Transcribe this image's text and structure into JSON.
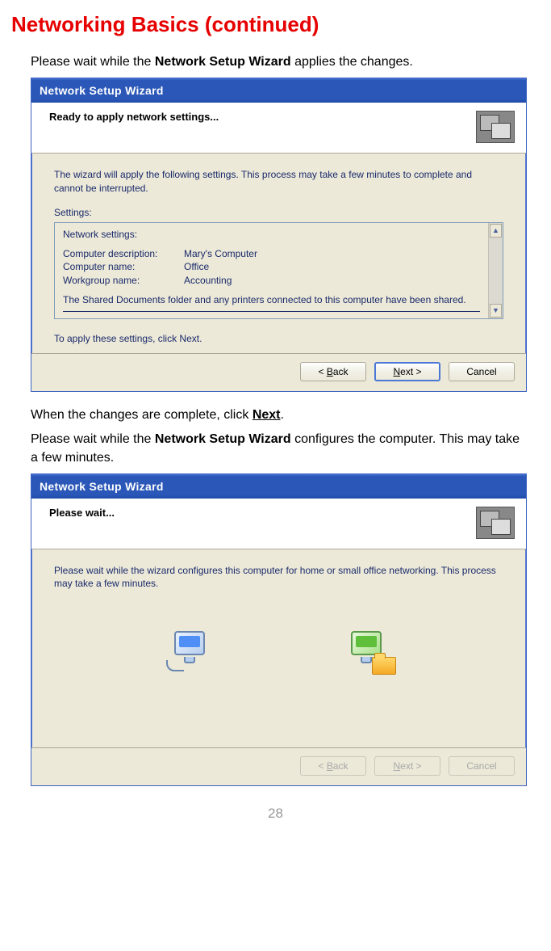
{
  "page": {
    "title": "Networking Basics (continued)",
    "intro_prefix": "Please wait while the ",
    "intro_bold": "Network Setup Wizard",
    "intro_suffix": " applies the changes.",
    "mid1_prefix": "When the changes are complete, click ",
    "mid1_bold": "Next",
    "mid1_suffix": ".",
    "mid2_prefix": "Please wait while the ",
    "mid2_bold": "Network Setup Wizard",
    "mid2_suffix": " configures the computer. This may take a few minutes.",
    "page_number": "28"
  },
  "dialog1": {
    "title": "Network Setup Wizard",
    "header": "Ready to apply network settings...",
    "para1": "The wizard will apply the following settings. This process may take a few minutes to complete and cannot be interrupted.",
    "settings_label": "Settings:",
    "box": {
      "heading": "Network settings:",
      "rows": [
        {
          "k": "Computer description:",
          "v": "Mary's Computer"
        },
        {
          "k": "Computer name:",
          "v": "Office"
        },
        {
          "k": "Workgroup name:",
          "v": "Accounting"
        }
      ],
      "note": "The Shared Documents folder and any printers connected to this computer have been shared."
    },
    "apply_text": "To apply these settings, click Next.",
    "buttons": {
      "back_pre": "< ",
      "back_u": "B",
      "back_post": "ack",
      "next_u": "N",
      "next_post": "ext >",
      "cancel": "Cancel"
    }
  },
  "dialog2": {
    "title": "Network Setup Wizard",
    "header": "Please wait...",
    "para1": "Please wait while the wizard configures this computer for home or small office networking. This process may take a few minutes.",
    "buttons": {
      "back_pre": "< ",
      "back_u": "B",
      "back_post": "ack",
      "next_u": "N",
      "next_post": "ext >",
      "cancel": "Cancel"
    }
  }
}
